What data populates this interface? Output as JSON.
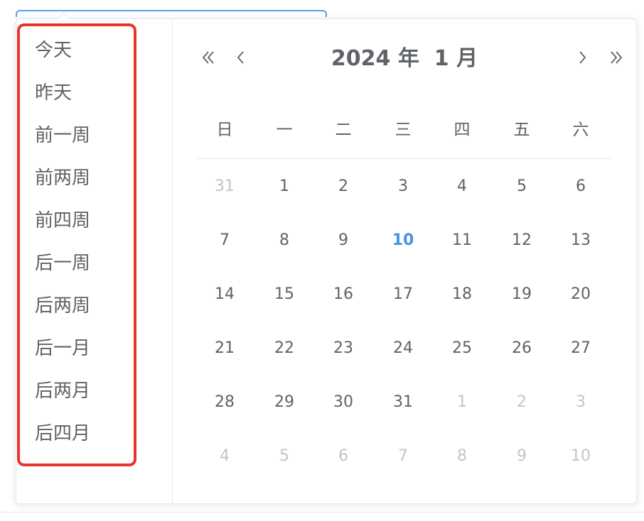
{
  "colors": {
    "accent": "#4a90e8",
    "highlight_border": "#e8352b",
    "text": "#5f6266",
    "muted": "#c0c4cc"
  },
  "shortcuts": [
    "今天",
    "昨天",
    "前一周",
    "前两周",
    "前四周",
    "后一周",
    "后两周",
    "后一月",
    "后两月",
    "后四月"
  ],
  "header": {
    "title": "2024 年  1 月",
    "prev_year_icon": "double-chevron-left-icon",
    "prev_month_icon": "chevron-left-icon",
    "next_month_icon": "chevron-right-icon",
    "next_year_icon": "double-chevron-right-icon"
  },
  "weekdays": [
    "日",
    "一",
    "二",
    "三",
    "四",
    "五",
    "六"
  ],
  "weeks": [
    [
      {
        "d": "31",
        "o": true
      },
      {
        "d": "1"
      },
      {
        "d": "2"
      },
      {
        "d": "3"
      },
      {
        "d": "4"
      },
      {
        "d": "5"
      },
      {
        "d": "6"
      }
    ],
    [
      {
        "d": "7"
      },
      {
        "d": "8"
      },
      {
        "d": "9"
      },
      {
        "d": "10",
        "t": true
      },
      {
        "d": "11"
      },
      {
        "d": "12"
      },
      {
        "d": "13"
      }
    ],
    [
      {
        "d": "14"
      },
      {
        "d": "15"
      },
      {
        "d": "16"
      },
      {
        "d": "17"
      },
      {
        "d": "18"
      },
      {
        "d": "19"
      },
      {
        "d": "20"
      }
    ],
    [
      {
        "d": "21"
      },
      {
        "d": "22"
      },
      {
        "d": "23"
      },
      {
        "d": "24"
      },
      {
        "d": "25"
      },
      {
        "d": "26"
      },
      {
        "d": "27"
      }
    ],
    [
      {
        "d": "28"
      },
      {
        "d": "29"
      },
      {
        "d": "30"
      },
      {
        "d": "31"
      },
      {
        "d": "1",
        "o": true
      },
      {
        "d": "2",
        "o": true
      },
      {
        "d": "3",
        "o": true
      }
    ],
    [
      {
        "d": "4",
        "o": true
      },
      {
        "d": "5",
        "o": true
      },
      {
        "d": "6",
        "o": true
      },
      {
        "d": "7",
        "o": true
      },
      {
        "d": "8",
        "o": true
      },
      {
        "d": "9",
        "o": true
      },
      {
        "d": "10",
        "o": true
      }
    ]
  ]
}
